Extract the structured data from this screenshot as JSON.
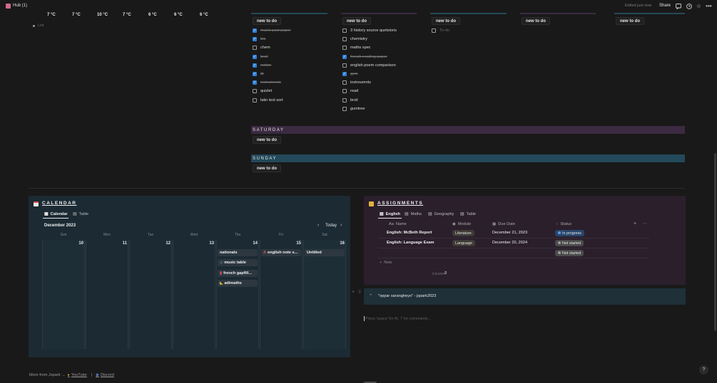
{
  "topbar": {
    "page_icon": "notebook-icon",
    "title": "Hub (1)",
    "edited": "Edited just now",
    "share": "Share",
    "icons": [
      "comment-icon",
      "clock-icon",
      "star-icon",
      "more-icon"
    ]
  },
  "weather": {
    "temps": [
      "7 °C",
      "7 °C",
      "10 °C",
      "7 °C",
      "6 °C",
      "6 °C",
      "6 °C"
    ],
    "list_placeholder": "List"
  },
  "colors": {
    "accent_blue": "#2f7fd8",
    "calendar_bg": "#1b2a33",
    "assignments_bg": "#2b1f2c",
    "teal_bar": "#23495a",
    "purple_bar": "#3b2a41"
  },
  "week": {
    "columns": [
      {
        "new_label": "new to do",
        "items": [
          {
            "label": "music past paper",
            "done": true
          },
          {
            "label": "bio",
            "done": true
          },
          {
            "label": "chem",
            "done": false
          },
          {
            "label": "broil",
            "done": true
          },
          {
            "label": "notion",
            "done": true
          },
          {
            "label": "ttt",
            "done": true
          },
          {
            "label": "instrumnets",
            "done": true
          },
          {
            "label": "quizlet",
            "done": false
          },
          {
            "label": "latin text sort",
            "done": false
          }
        ]
      },
      {
        "new_label": "new to do",
        "items": [
          {
            "label": "3 history source quetsions",
            "done": false
          },
          {
            "label": "chemistry",
            "done": false
          },
          {
            "label": "maths spec",
            "done": false
          },
          {
            "label": "french reading paper",
            "done": true
          },
          {
            "label": "english poem comparison",
            "done": false
          },
          {
            "label": "gym",
            "done": true
          },
          {
            "label": "instreumnts",
            "done": false
          },
          {
            "label": "read",
            "done": false
          },
          {
            "label": "broil",
            "done": false
          },
          {
            "label": "gumtree",
            "done": false
          }
        ]
      },
      {
        "new_label": "new to do",
        "items": [
          {
            "label": "To-do",
            "done": false,
            "placeholder": true
          }
        ]
      },
      {
        "new_label": "new to do",
        "items": []
      },
      {
        "new_label": "new to do",
        "items": []
      }
    ],
    "saturday": {
      "title": "SATURDAY",
      "new_label": "new to do"
    },
    "sunday": {
      "title": "SUNDAY",
      "new_label": "new to do"
    }
  },
  "calendar": {
    "icon": "calendar-icon",
    "title": "CALENDAR",
    "tabs": [
      {
        "label": "Calendar",
        "icon": "calendar-view-icon"
      },
      {
        "label": "Table",
        "icon": "table-icon"
      }
    ],
    "month": "December 2023",
    "today": "Today",
    "weekdays": [
      "Sun",
      "Mon",
      "Tue",
      "Wed",
      "Thu",
      "Fri",
      "Sat"
    ],
    "days": [
      "10",
      "11",
      "12",
      "13",
      "14",
      "15",
      "16"
    ],
    "events": {
      "thu": [
        "nationals",
        "music table",
        "french gapfill...",
        "adimaths"
      ],
      "fri": [
        "english note s..."
      ],
      "sat": [
        "Untitled"
      ]
    }
  },
  "assignments": {
    "icon": "folder-icon",
    "title": "ASSIGNMENTS",
    "tabs": [
      {
        "label": "English",
        "icon": "table-icon"
      },
      {
        "label": "Maths",
        "icon": "table-icon"
      },
      {
        "label": "Geography",
        "icon": "table-icon"
      },
      {
        "label": "Table",
        "icon": "table-icon"
      }
    ],
    "headers": {
      "name": "Name",
      "module": "Module",
      "due": "Due Date",
      "status": "Status"
    },
    "rows": [
      {
        "name": "English: McBeth Report",
        "module": "Literature",
        "due": "December 21, 2023",
        "status": "In progress"
      },
      {
        "name": "English: Language Exam",
        "module": "Language",
        "due": "December 20, 2024",
        "status": "Not started"
      },
      {
        "name": "",
        "module": "",
        "due": "",
        "status": "Not started"
      }
    ],
    "new_label": "New",
    "count_label": "COUNT",
    "count_value": "3",
    "status_colors": {
      "in_progress": "#28456c",
      "not_started": "#4a4a4a"
    }
  },
  "quote": {
    "icon": "quote-icon",
    "text": "\"oppar sarangheyo\" - jspark2023"
  },
  "editor": {
    "placeholder": "Press 'space' for AI, '/' for commands..."
  },
  "footer": {
    "prefix": "More from Jspark →",
    "link1": "YouTube",
    "link2": "Discord"
  },
  "help": "?"
}
